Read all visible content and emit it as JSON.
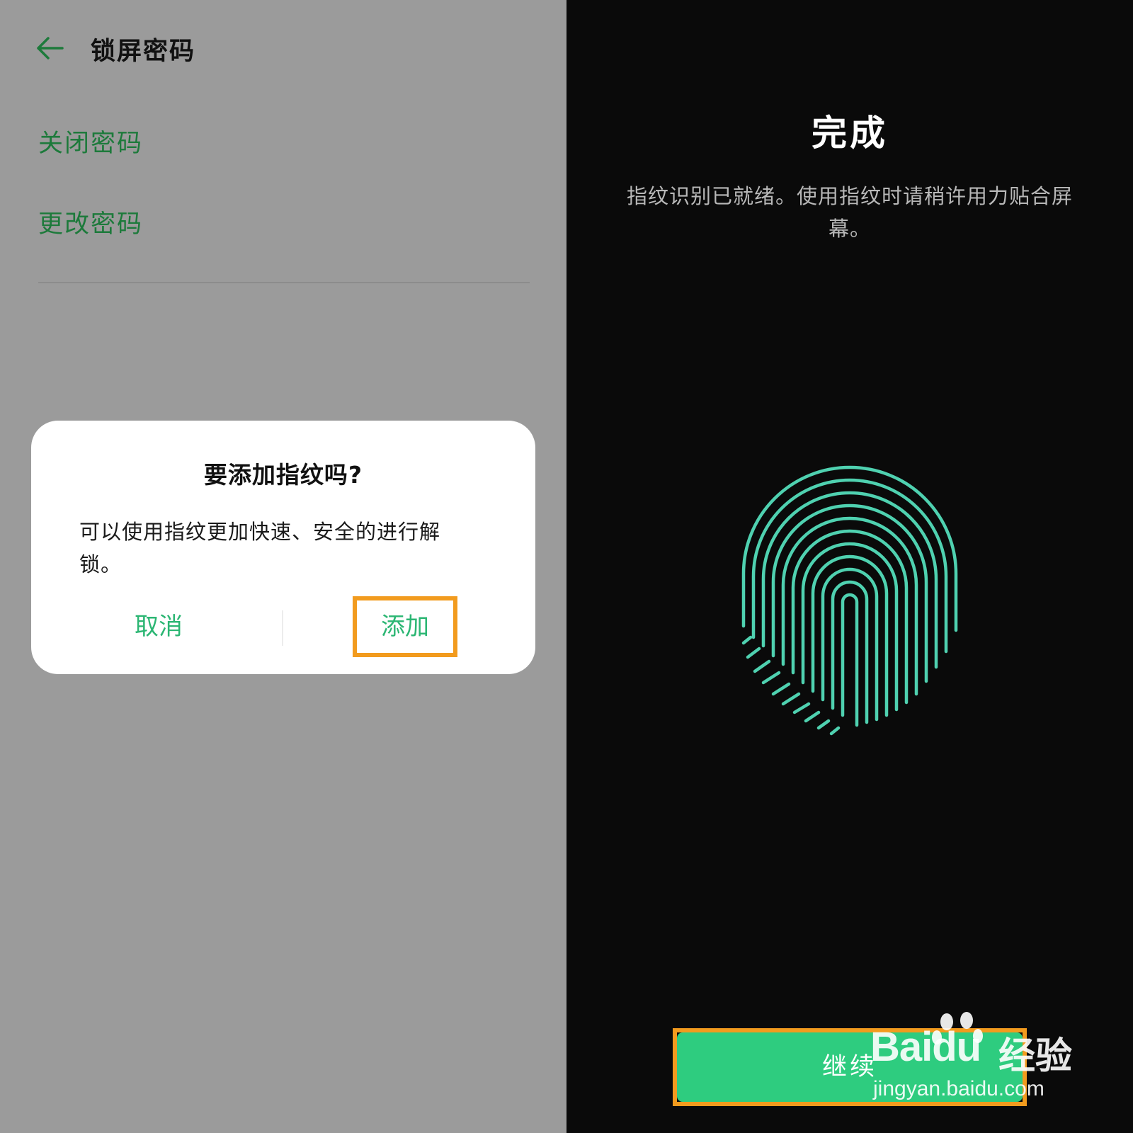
{
  "left_screen": {
    "header": {
      "title": "锁屏密码"
    },
    "menu": [
      {
        "label": "关闭密码"
      },
      {
        "label": "更改密码"
      }
    ],
    "dialog": {
      "title": "要添加指纹吗?",
      "message_line1": "可以使用指纹更加快速、安全的进行解",
      "message_line2": "锁。",
      "cancel_label": "取消",
      "add_label": "添加"
    }
  },
  "right_screen": {
    "title": "完成",
    "description_line1": "指纹识别已就绪。使用指纹时请稍许用力贴合屏",
    "description_line2": "幕。",
    "continue_label": "继续"
  },
  "watermark": {
    "brand": "Baidu",
    "brand_cn": "经验",
    "url": "jingyan.baidu.com"
  },
  "colors": {
    "accent_green": "#2bb673",
    "menu_green": "#1d7a3b",
    "highlight_orange": "#f29b1e",
    "fingerprint_teal": "#4fd1b0",
    "left_bg": "#9b9b9b",
    "right_bg": "#0a0a0a"
  }
}
